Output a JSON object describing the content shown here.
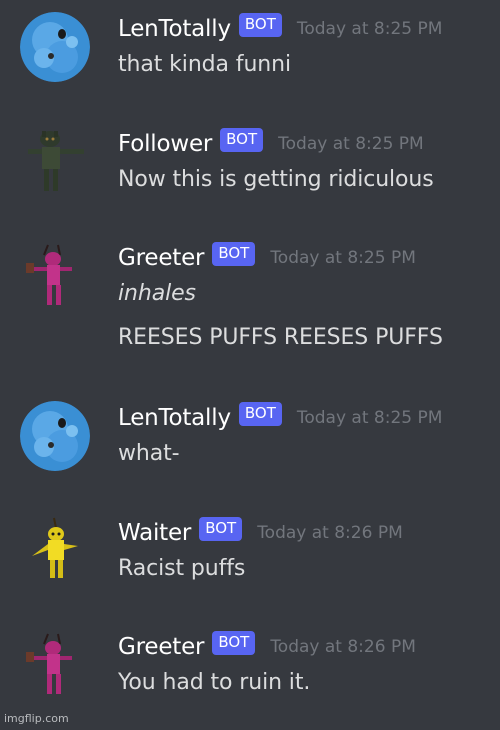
{
  "messages": [
    {
      "username": "LenTotally",
      "badge": "BOT",
      "timestamp": "Today at 8:25 PM",
      "lines": [
        "that kinda funni"
      ],
      "avatar": "blue-fluffy-avatar",
      "name_color": "#ffffff"
    },
    {
      "username": "Follower",
      "badge": "BOT",
      "timestamp": "Today at 8:25 PM",
      "lines": [
        "Now this is getting ridiculous"
      ],
      "avatar": "dark-green-animatronic-avatar",
      "name_color": "#ffffff"
    },
    {
      "username": "Greeter",
      "badge": "BOT",
      "timestamp": "Today at 8:25 PM",
      "lines": [
        "inhales",
        "REESES PUFFS REESES PUFFS"
      ],
      "avatar": "pink-animatronic-avatar",
      "name_color": "#ffffff"
    },
    {
      "username": "LenTotally",
      "badge": "BOT",
      "timestamp": "Today at 8:25 PM",
      "lines": [
        "what-"
      ],
      "avatar": "blue-fluffy-avatar",
      "name_color": "#ffffff"
    },
    {
      "username": "Waiter",
      "badge": "BOT",
      "timestamp": "Today at 8:26 PM",
      "lines": [
        "Racist puffs"
      ],
      "avatar": "yellow-animatronic-avatar",
      "name_color": "#ffffff"
    },
    {
      "username": "Greeter",
      "badge": "BOT",
      "timestamp": "Today at 8:26 PM",
      "lines": [
        "You had to ruin it."
      ],
      "avatar": "pink-animatronic-avatar",
      "name_color": "#ffffff"
    }
  ],
  "watermark": "imgflip.com",
  "colors": {
    "background": "#36393f",
    "badge": "#5865f2",
    "timestamp": "#72767d",
    "text": "#dcddde"
  }
}
